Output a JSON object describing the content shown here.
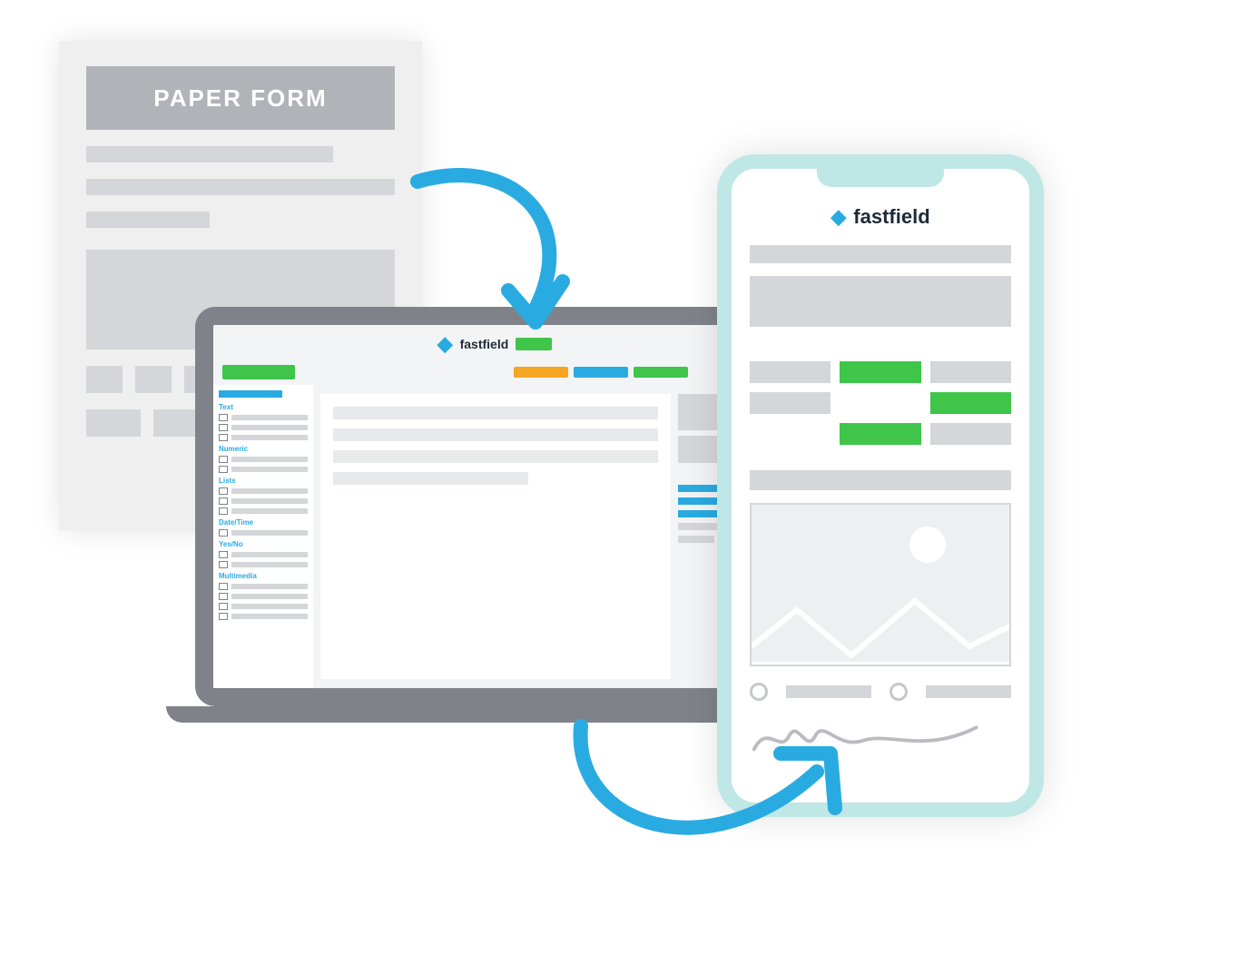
{
  "paper": {
    "title": "PAPER FORM"
  },
  "brand": {
    "name": "fastfield"
  },
  "laptop": {
    "sidebar": {
      "categories": [
        "Text",
        "Numeric",
        "Lists",
        "Date/Time",
        "Yes/No",
        "Multimedia"
      ]
    }
  },
  "colors": {
    "accent_blue": "#29abe2",
    "green": "#3ec54a",
    "orange": "#f5a623",
    "phone_frame": "#bfe7e5",
    "laptop_frame": "#7f8389"
  }
}
